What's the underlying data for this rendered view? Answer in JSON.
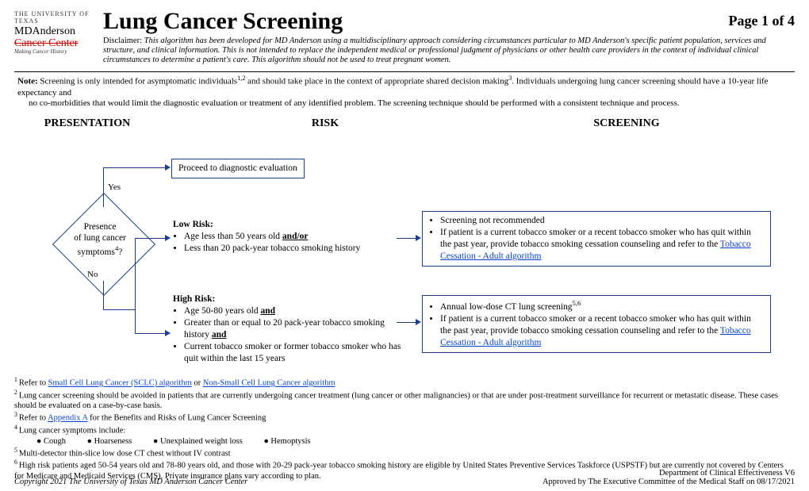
{
  "logo": {
    "line1": "THE UNIVERSITY OF TEXAS",
    "line2": "MDAnderson",
    "line3": "Cancer Center",
    "tag": "Making Cancer History"
  },
  "title": "Lung Cancer Screening",
  "page": "Page 1 of 4",
  "disclaimer_label": "Disclaimer:",
  "disclaimer": "This algorithm has been developed for MD Anderson using a multidisciplinary approach considering circumstances particular to MD Anderson's specific patient population, services and structure, and clinical information. This is not intended to replace the independent medical or professional judgment of physicians or other health care providers in the context of individual clinical circumstances to determine a patient's care. This algorithm should not be used to treat pregnant women.",
  "note": {
    "label": "Note:",
    "text1": " Screening is only intended for asymptomatic individuals",
    "sup1": "1,2",
    "text2": " and should take place in the context of appropriate shared decision making",
    "sup2": "3",
    "text3": ".  Individuals undergoing lung cancer screening should have a 10-year life expectancy and",
    "text4": "no co-morbidities that would limit the diagnostic evaluation or treatment of any identified problem. The screening technique should be performed with a consistent technique and process."
  },
  "cols": {
    "a": "PRESENTATION",
    "b": "RISK",
    "c": "SCREENING"
  },
  "diagram": {
    "diamond": {
      "l1": "Presence",
      "l2": "of lung cancer",
      "l3": "symptoms",
      "sup": "4",
      "q": "?"
    },
    "yes": "Yes",
    "no": "No",
    "proceed": "Proceed to diagnostic evaluation",
    "lowrisk": {
      "title": "Low Risk:",
      "b1": "Age less than 50 years old ",
      "andor": "and/or",
      "b2": "Less than 20 pack-year tobacco smoking history"
    },
    "highrisk": {
      "title": "High Risk:",
      "b1": "Age 50-80 years old ",
      "and1": "and",
      "b2": "Greater than or equal to 20 pack-year tobacco smoking history ",
      "and2": "and",
      "b3": "Current tobacco smoker or former tobacco smoker who has quit within the last 15 years"
    },
    "scr_low": {
      "b1": "Screening not recommended",
      "b2a": "If patient is a current tobacco smoker or a recent tobacco smoker who has quit within the past year, provide tobacco smoking cessation counseling and refer to the ",
      "link": "Tobacco Cessation - Adult algorithm"
    },
    "scr_high": {
      "b1a": "Annual low-dose CT lung screening",
      "sup": "5,6",
      "b2a": "If patient is a current tobacco smoker or a recent tobacco smoker who has quit within the past year, provide tobacco smoking cessation counseling and refer to the ",
      "link": "Tobacco Cessation - Adult algorithm"
    }
  },
  "fn": {
    "f1a": "Refer to ",
    "f1link1": "Small Cell Lung Cancer (SCLC) algorithm",
    "f1b": " or ",
    "f1link2": "Non-Small Cell Lung Cancer algorithm",
    "f2": "Lung cancer screening should be avoided in patients that are currently undergoing cancer treatment (lung cancer or other malignancies) or that are under post-treatment surveillance for recurrent or metastatic disease. These cases should be evaluated on a case-by-case basis.",
    "f3a": "Refer to ",
    "f3link": "Appendix A",
    "f3b": " for the Benefits and Risks of Lung Cancer Screening",
    "f4": "Lung cancer symptoms include:",
    "f4syms": {
      "a": "Cough",
      "b": "Hoarseness",
      "c": "Unexplained weight loss",
      "d": "Hemoptysis"
    },
    "f5": "Multi-detector thin-slice low dose CT chest without IV contrast",
    "f6": "High risk patients aged 50-54 years old and 78-80 years old, and those with 20-29 pack-year tobacco smoking history are eligible by United States Preventive Services Taskforce (USPSTF) but are currently not covered by Centers for Medicare and Medicaid Services (CMS). Private insurance plans vary according to plan."
  },
  "footer": {
    "left": "Copyright 2021 The University of Texas MD Anderson Cancer Center",
    "r1": "Department of Clinical Effectiveness V6",
    "r2": "Approved by The Executive Committee of the Medical Staff on 08/17/2021"
  }
}
